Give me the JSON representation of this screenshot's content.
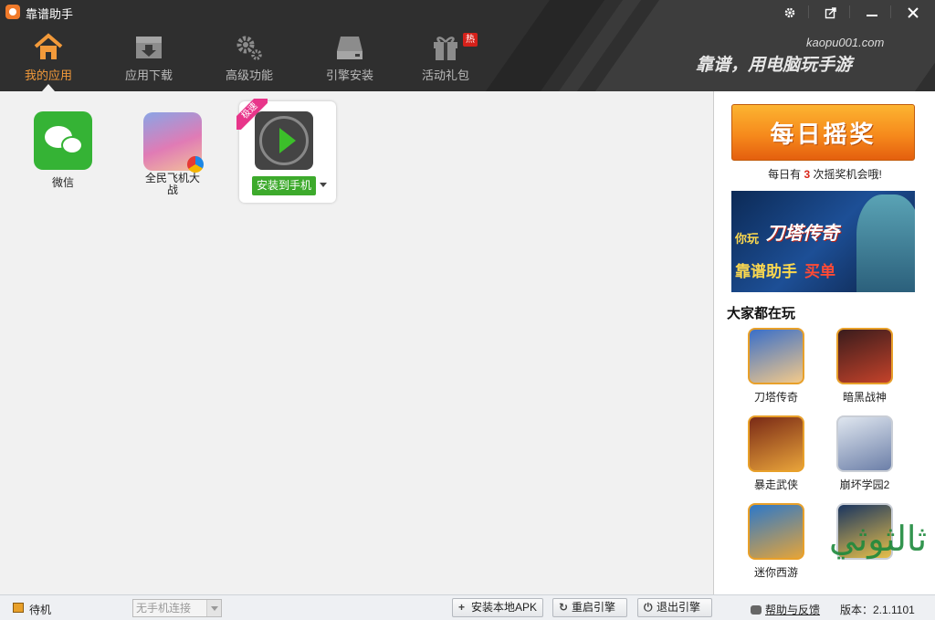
{
  "window": {
    "title": "靠谱助手",
    "controls": [
      "settings",
      "restore",
      "minimize",
      "close"
    ]
  },
  "nav": {
    "items": [
      {
        "label": "我的应用",
        "icon": "home-icon",
        "active": true
      },
      {
        "label": "应用下载",
        "icon": "download-box-icon"
      },
      {
        "label": "高级功能",
        "icon": "gears-icon"
      },
      {
        "label": "引擎安装",
        "icon": "drive-icon"
      },
      {
        "label": "活动礼包",
        "icon": "gift-icon",
        "badge": "热"
      }
    ]
  },
  "brand": {
    "url": "kaopu001.com",
    "slogan": "靠谱，用电脑玩手游"
  },
  "apps": [
    {
      "name": "微信",
      "icon": "wechat-icon"
    },
    {
      "name": "全民飞机大战",
      "icon": "game-icon"
    },
    {
      "name": "",
      "icon": "player-icon",
      "ribbon": "极速",
      "install_label": "安装到手机"
    }
  ],
  "sidebar": {
    "lottery": {
      "button_label": "每日摇奖",
      "info_prefix": "每日有",
      "count": "3",
      "info_suffix": "次摇奖机会哦!"
    },
    "banner": {
      "line1": "你玩",
      "line2": "刀塔传奇",
      "line3": "靠谱助手",
      "line4": "买单"
    },
    "popular_title": "大家都在玩",
    "popular": [
      {
        "name": "刀塔传奇",
        "colors": [
          "#3a6fc9",
          "#f3c98a"
        ]
      },
      {
        "name": "暗黑战神",
        "colors": [
          "#3a1c1c",
          "#c4422a"
        ]
      },
      {
        "name": "暴走武侠",
        "colors": [
          "#7a2a16",
          "#e8a33a"
        ]
      },
      {
        "name": "崩坏学园2",
        "colors": [
          "#dfe6ef",
          "#6c7fa8"
        ]
      },
      {
        "name": "迷你西游",
        "colors": [
          "#2d78c9",
          "#e4a43a"
        ]
      },
      {
        "name": "",
        "colors": [
          "#1a3560",
          "#e8c04a"
        ]
      }
    ]
  },
  "status": {
    "state": "待机",
    "device_select": "无手机连接",
    "buttons": [
      {
        "label": "安装本地APK",
        "glyph": "+"
      },
      {
        "label": "重启引擎",
        "glyph": "↻"
      },
      {
        "label": "退出引擎",
        "glyph": "⏻"
      }
    ],
    "help_link": "帮助与反馈",
    "version": "版本：2.1.1101"
  },
  "watermark": "ثالثوثي",
  "colors": {
    "header_bg": "#2f2f2f",
    "accent_orange": "#f39a3a",
    "install_green": "#3daa2c"
  }
}
